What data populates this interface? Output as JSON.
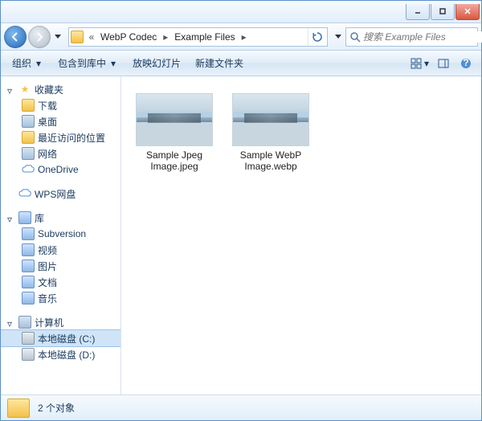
{
  "window": {
    "breadcrumb": {
      "seg1": "WebP Codec",
      "seg2": "Example Files",
      "prefix": "«"
    },
    "search_placeholder": "搜索 Example Files"
  },
  "toolbar": {
    "organize": "组织",
    "include": "包含到库中",
    "slideshow": "放映幻灯片",
    "newfolder": "新建文件夹"
  },
  "nav": {
    "favorites": {
      "label": "收藏夹",
      "download": "下载",
      "desktop": "桌面",
      "recent": "最近访问的位置",
      "network": "网络",
      "onedrive": "OneDrive"
    },
    "wps": "WPS网盘",
    "libraries": {
      "label": "库",
      "subversion": "Subversion",
      "videos": "视频",
      "pictures": "图片",
      "documents": "文档",
      "music": "音乐"
    },
    "computer": {
      "label": "计算机",
      "c": "本地磁盘 (C:)",
      "d": "本地磁盘 (D:)"
    }
  },
  "files": [
    {
      "name": "Sample Jpeg Image.jpeg"
    },
    {
      "name": "Sample WebP Image.webp"
    }
  ],
  "status": {
    "count": "2 个对象"
  }
}
